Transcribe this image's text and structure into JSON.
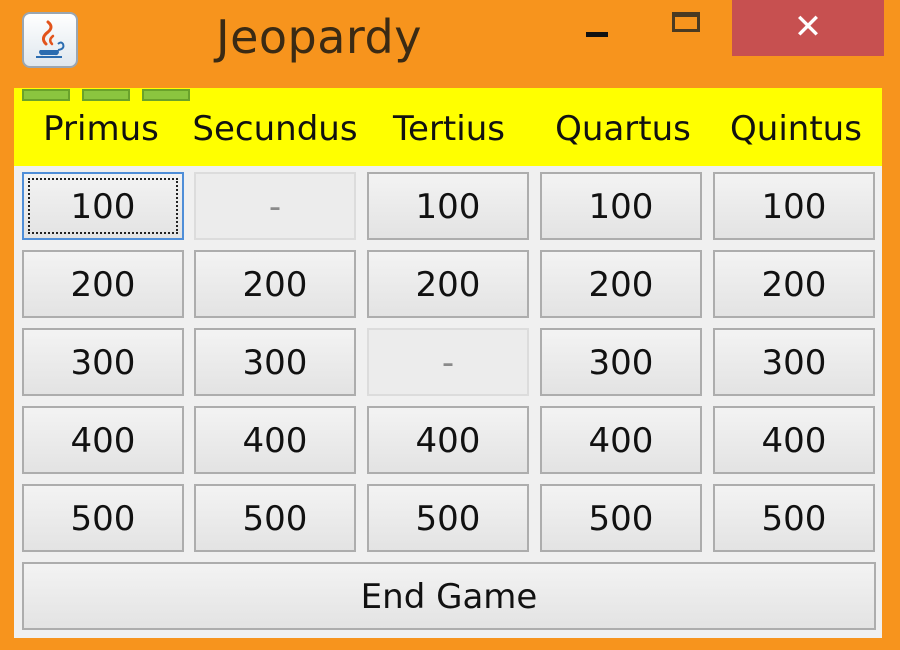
{
  "window": {
    "title": "Jeopardy",
    "close_glyph": "✕",
    "icon": "java-cup-icon",
    "colors": {
      "frame": "#f7941d",
      "header": "#ffff00",
      "close": "#c75050",
      "focus": "#4f8ed8"
    }
  },
  "board": {
    "categories": [
      "Primus",
      "Secundus",
      "Tertius",
      "Quartus",
      "Quintus"
    ],
    "rows": [
      [
        "100",
        "-",
        "100",
        "100",
        "100"
      ],
      [
        "200",
        "200",
        "200",
        "200",
        "200"
      ],
      [
        "300",
        "300",
        "-",
        "300",
        "300"
      ],
      [
        "400",
        "400",
        "400",
        "400",
        "400"
      ],
      [
        "500",
        "500",
        "500",
        "500",
        "500"
      ]
    ],
    "used_marker": "-",
    "focused_cell": [
      0,
      0
    ],
    "end_label": "End Game"
  }
}
